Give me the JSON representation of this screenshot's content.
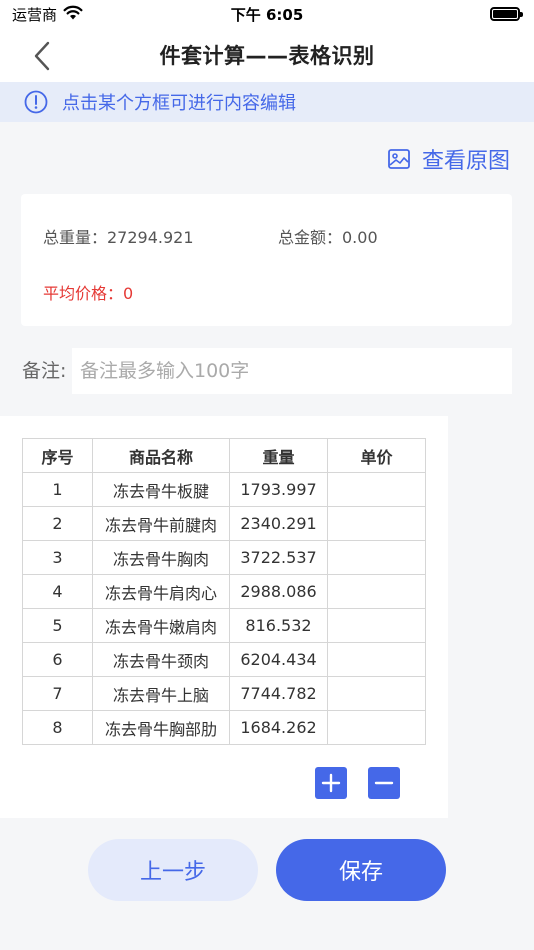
{
  "status_bar": {
    "carrier": "运营商",
    "time": "下午 6:05"
  },
  "nav": {
    "title": "件套计算——表格识别"
  },
  "tip": {
    "text": "点击某个方框可进行内容编辑"
  },
  "view_original": {
    "label": "查看原图"
  },
  "summary": {
    "total_weight": "总重量：27294.921",
    "total_amount": "总金额：0.00",
    "avg_price": "平均价格：0"
  },
  "remark": {
    "label": "备注:",
    "placeholder": "备注最多输入100字",
    "value": ""
  },
  "table": {
    "headers": {
      "no": "序号",
      "name": "商品名称",
      "weight": "重量",
      "price": "单价"
    },
    "rows": [
      {
        "no": "1",
        "name": "冻去骨牛板腱",
        "weight": "1793.997",
        "price": ""
      },
      {
        "no": "2",
        "name": "冻去骨牛前腱肉",
        "weight": "2340.291",
        "price": ""
      },
      {
        "no": "3",
        "name": "冻去骨牛胸肉",
        "weight": "3722.537",
        "price": ""
      },
      {
        "no": "4",
        "name": "冻去骨牛肩肉心",
        "weight": "2988.086",
        "price": ""
      },
      {
        "no": "5",
        "name": "冻去骨牛嫩肩肉",
        "weight": "816.532",
        "price": ""
      },
      {
        "no": "6",
        "name": "冻去骨牛颈肉",
        "weight": "6204.434",
        "price": ""
      },
      {
        "no": "7",
        "name": "冻去骨牛上脑",
        "weight": "7744.782",
        "price": ""
      },
      {
        "no": "8",
        "name": "冻去骨牛胸部肋",
        "weight": "1684.262",
        "price": ""
      }
    ]
  },
  "buttons": {
    "prev": "上一步",
    "save": "保存"
  },
  "colors": {
    "accent": "#4568e8",
    "warning": "#e53935",
    "banner_bg": "#e6ecf9"
  },
  "icons": [
    "wifi-icon",
    "battery-icon",
    "back-chevron-icon",
    "info-icon",
    "image-icon",
    "plus-icon",
    "minus-icon"
  ]
}
